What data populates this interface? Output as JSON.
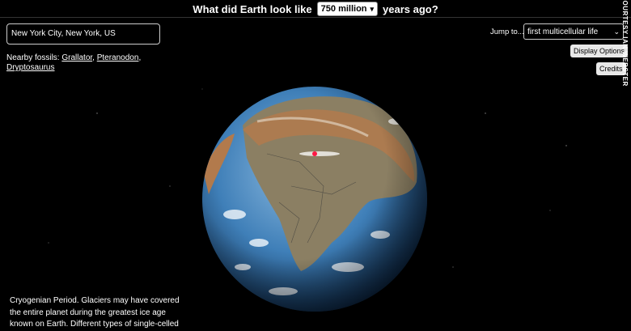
{
  "header": {
    "title_before": "What did Earth look like",
    "year_selected": "750 million",
    "title_after": "years ago?"
  },
  "location": {
    "value": "New York City, New York, US"
  },
  "fossils": {
    "label": "Nearby fossils:",
    "items": [
      "Grallator",
      "Pteranodon",
      "Dryptosaurus"
    ]
  },
  "jump": {
    "label": "Jump to...",
    "selected": "first multicellular life"
  },
  "buttons": {
    "display_options": "Display Options",
    "credits": "Credits"
  },
  "courtesy": "COURTESY IAN WEBSTER",
  "description": "Cryogenian Period. Glaciers may have covered the entire planet during the greatest ice age known on Earth. Different types of single-celled",
  "colors": {
    "background": "#000000",
    "ocean": "#3f7fb8",
    "land": "#8b7f63",
    "marker": "#ff1744"
  }
}
